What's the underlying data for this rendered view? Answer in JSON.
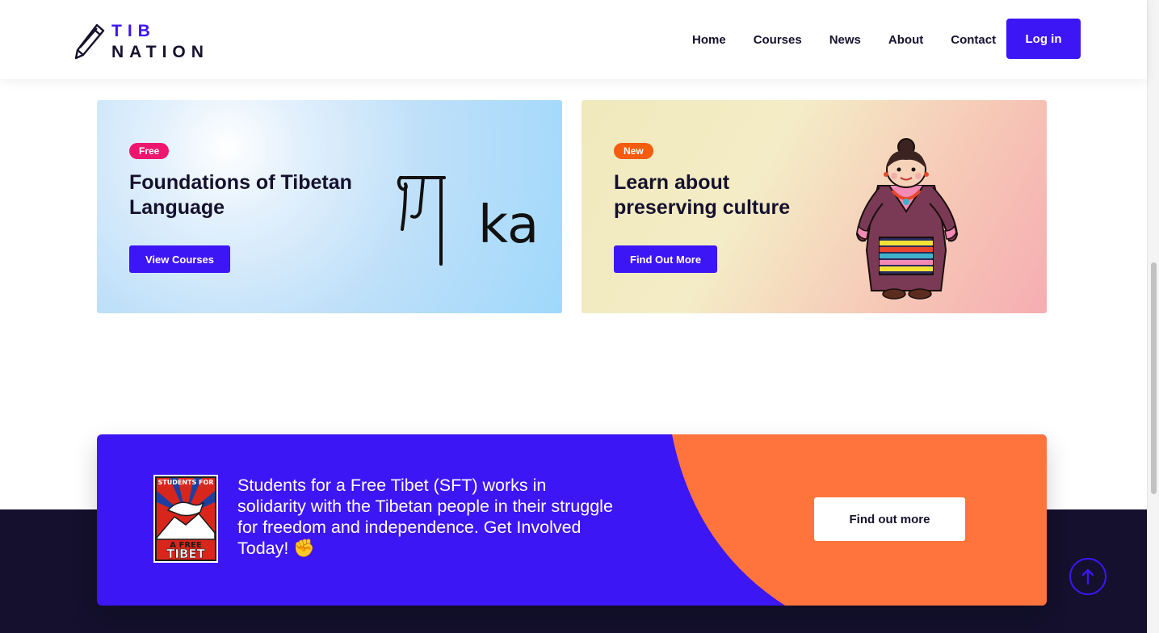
{
  "header": {
    "logo_line1": "TIB",
    "logo_line2": "NATION",
    "nav": [
      "Home",
      "Courses",
      "News",
      "About",
      "Contact"
    ],
    "login_label": "Log in"
  },
  "cards": [
    {
      "badge": "Free",
      "badge_color": "#f0166f",
      "title": "Foundations of Tibetan Language",
      "button": "View Courses",
      "illustration_text": "ka"
    },
    {
      "badge": "New",
      "badge_color": "#f65b0f",
      "title": "Learn about preserving culture",
      "button": "Find Out More"
    }
  ],
  "banner": {
    "text": "Students for a Free Tibet (SFT) works in solidarity with the Tibetan people in their struggle for freedom and independence. Get Involved Today! ✊",
    "button": "Find out more",
    "logo_text_top": "STUDENTS FOR",
    "logo_text_mid": "A FREE",
    "logo_text_bottom": "TIBET"
  },
  "colors": {
    "primary": "#3d16f5",
    "accent_orange": "#ff743d",
    "dark": "#14102d"
  }
}
